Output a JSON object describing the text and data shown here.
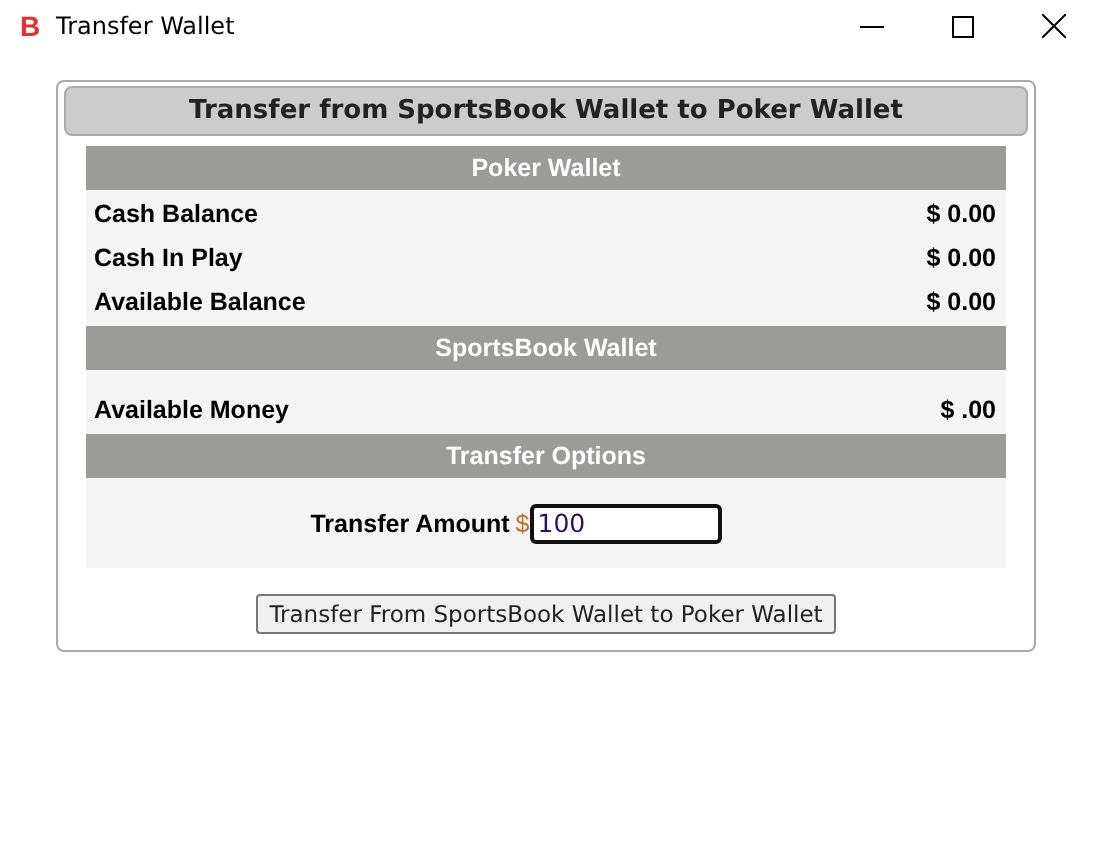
{
  "window": {
    "title": "Transfer Wallet",
    "icon_letter": "B"
  },
  "panel": {
    "title": "Transfer from SportsBook Wallet to Poker Wallet",
    "sections": [
      {
        "heading": "Poker Wallet",
        "rows": [
          {
            "label": "Cash Balance",
            "value": "$ 0.00"
          },
          {
            "label": "Cash In Play",
            "value": "$ 0.00"
          },
          {
            "label": "Available Balance",
            "value": "$ 0.00"
          }
        ]
      },
      {
        "heading": "SportsBook Wallet",
        "rows": [
          {
            "label": "Available Money",
            "value": "$ .00"
          }
        ]
      }
    ],
    "transfer": {
      "heading": "Transfer Options",
      "label": "Transfer Amount",
      "currency": "$",
      "value": "100"
    },
    "button": "Transfer From SportsBook Wallet to Poker Wallet"
  }
}
